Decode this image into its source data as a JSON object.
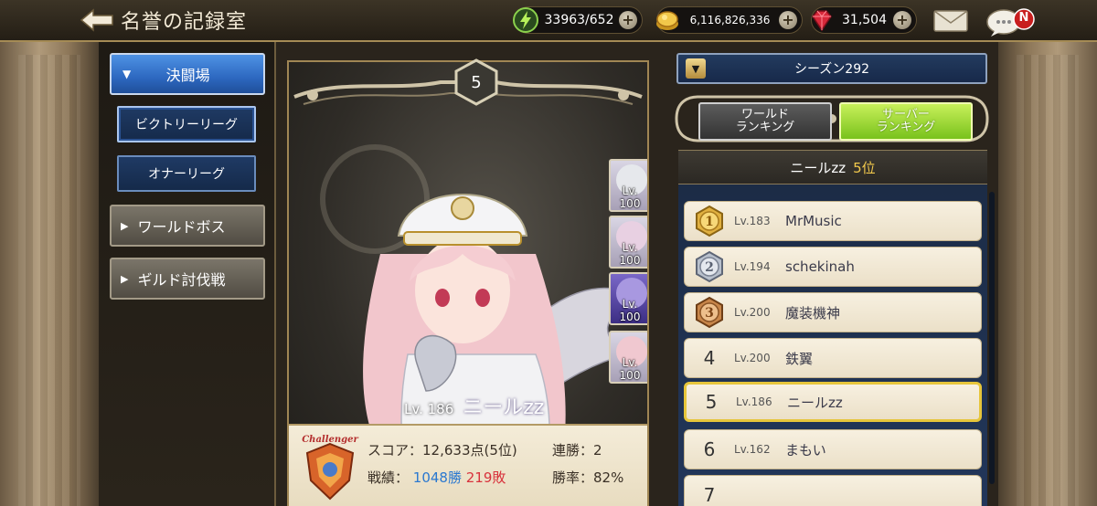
{
  "header": {
    "title": "名誉の記録室",
    "stamina": "33963/652",
    "gold": "6,116,826,336",
    "gems": "31,504",
    "notification_badge": "N"
  },
  "sidebar": {
    "main_label": "決闘場",
    "sub_items": [
      {
        "label": "ビクトリーリーグ",
        "active": true
      },
      {
        "label": "オナーリーグ",
        "active": false
      }
    ],
    "other_items": [
      {
        "label": "ワールドボス"
      },
      {
        "label": "ギルド討伐戦"
      }
    ]
  },
  "character": {
    "rank": "5",
    "level_label": "Lv. 186",
    "name": "ニールzz",
    "party": [
      {
        "level": "Lv. 100"
      },
      {
        "level": "Lv. 100"
      },
      {
        "level": "Lv. 100"
      },
      {
        "level": "Lv. 100"
      }
    ]
  },
  "stats": {
    "badge_text": "Challenger",
    "score": "スコア：12,633点(5位)",
    "streak": "連勝：2",
    "record_label": "戦績：",
    "wins": "1048勝",
    "losses": "219敗",
    "winrate": "勝率：82%"
  },
  "ranking": {
    "season": "シーズン292",
    "tab_world": "ワールド\nランキング",
    "tab_server": "サーバー\nランキング",
    "active_tab": "server",
    "self_name": "ニールzz",
    "self_rank": "5位",
    "rows": [
      {
        "rank": "1",
        "level": "Lv.183",
        "name": "MrMusic"
      },
      {
        "rank": "2",
        "level": "Lv.194",
        "name": "schekinah"
      },
      {
        "rank": "3",
        "level": "Lv.200",
        "name": "魔装機神"
      },
      {
        "rank": "4",
        "level": "Lv.200",
        "name": "鉄翼"
      },
      {
        "rank": "5",
        "level": "Lv.186",
        "name": "ニールzz"
      },
      {
        "rank": "6",
        "level": "Lv.162",
        "name": "まもい"
      },
      {
        "rank": "7",
        "level": "",
        "name": ""
      }
    ]
  },
  "colors": {
    "gold_medal": "#e0b040",
    "silver_medal": "#b8c0cc",
    "bronze_medal": "#c8864a",
    "win": "#2a78d0",
    "loss": "#d8323c",
    "active_tab": "#9ad63a"
  },
  "icons": {
    "back": "back-arrow-icon",
    "stamina": "lightning-icon",
    "gold": "gold-coin-icon",
    "gems": "ruby-icon",
    "mail": "mail-icon",
    "chat": "chat-icon"
  }
}
